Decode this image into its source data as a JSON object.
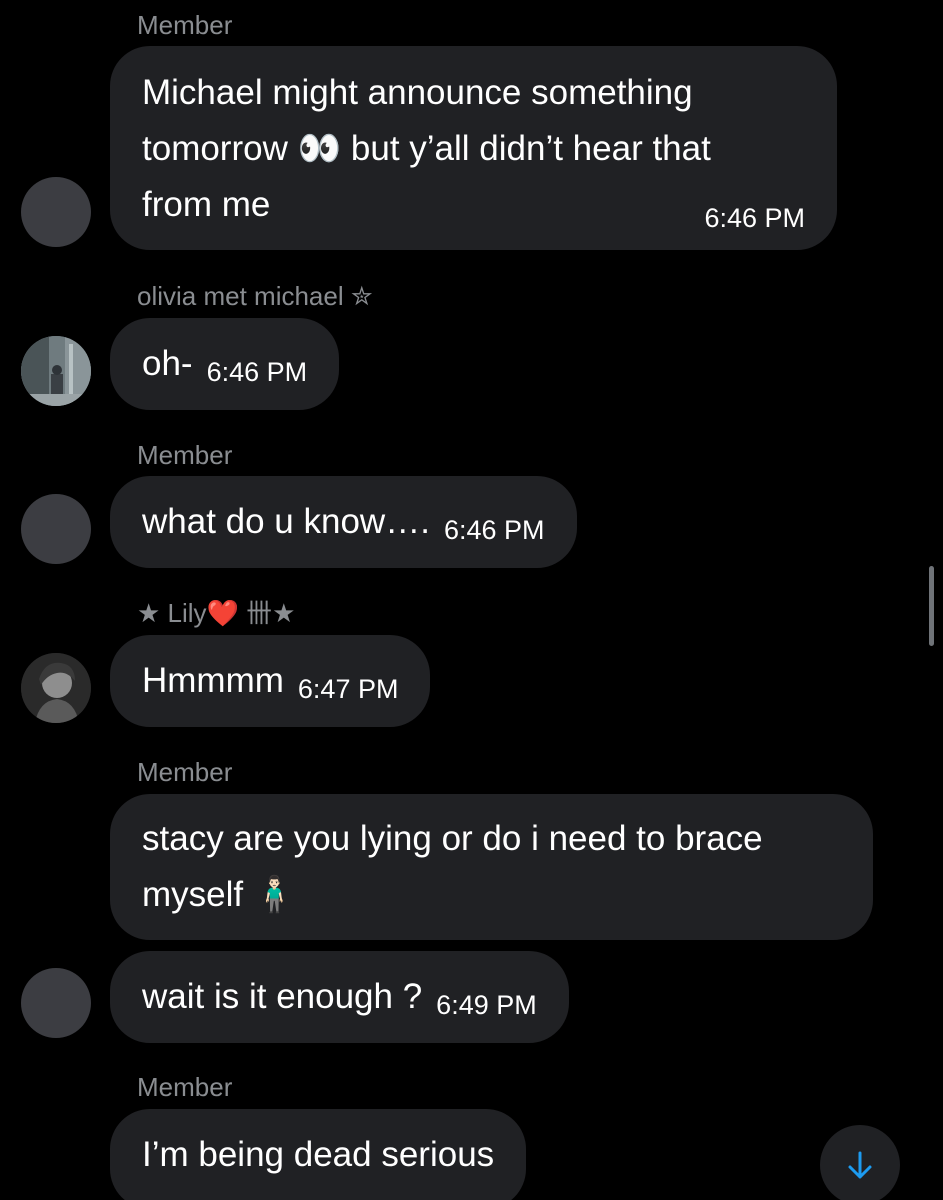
{
  "messages": [
    {
      "sender": "Member",
      "lines": [
        "Michael might announce something",
        "tomorrow 👀 but y’all didn’t hear that",
        "from me"
      ],
      "time": "6:46 PM"
    },
    {
      "sender": "olivia met michael ✮",
      "text": "oh-",
      "time": "6:46 PM"
    },
    {
      "sender": "Member",
      "text": "what do u know….",
      "time": "6:46 PM"
    },
    {
      "sender": "★ Lily❤️ 卌★",
      "text": "Hmmmm",
      "time": "6:47 PM"
    },
    {
      "sender": "Member",
      "lines": [
        "stacy are you lying or do i need to brace",
        "myself 🧍🏻‍♂️"
      ]
    },
    {
      "text": "wait is it enough ?",
      "time": "6:49 PM"
    },
    {
      "sender": "Member",
      "text": "I’m being dead serious"
    }
  ],
  "scroll_down_icon": "arrow-down-icon",
  "colors": {
    "background": "#000000",
    "bubble": "#202124",
    "sender_text": "#8a8d91",
    "message_text": "#ffffff",
    "avatar_placeholder": "#3c3d42",
    "scroll_arrow": "#1d9bf0"
  }
}
